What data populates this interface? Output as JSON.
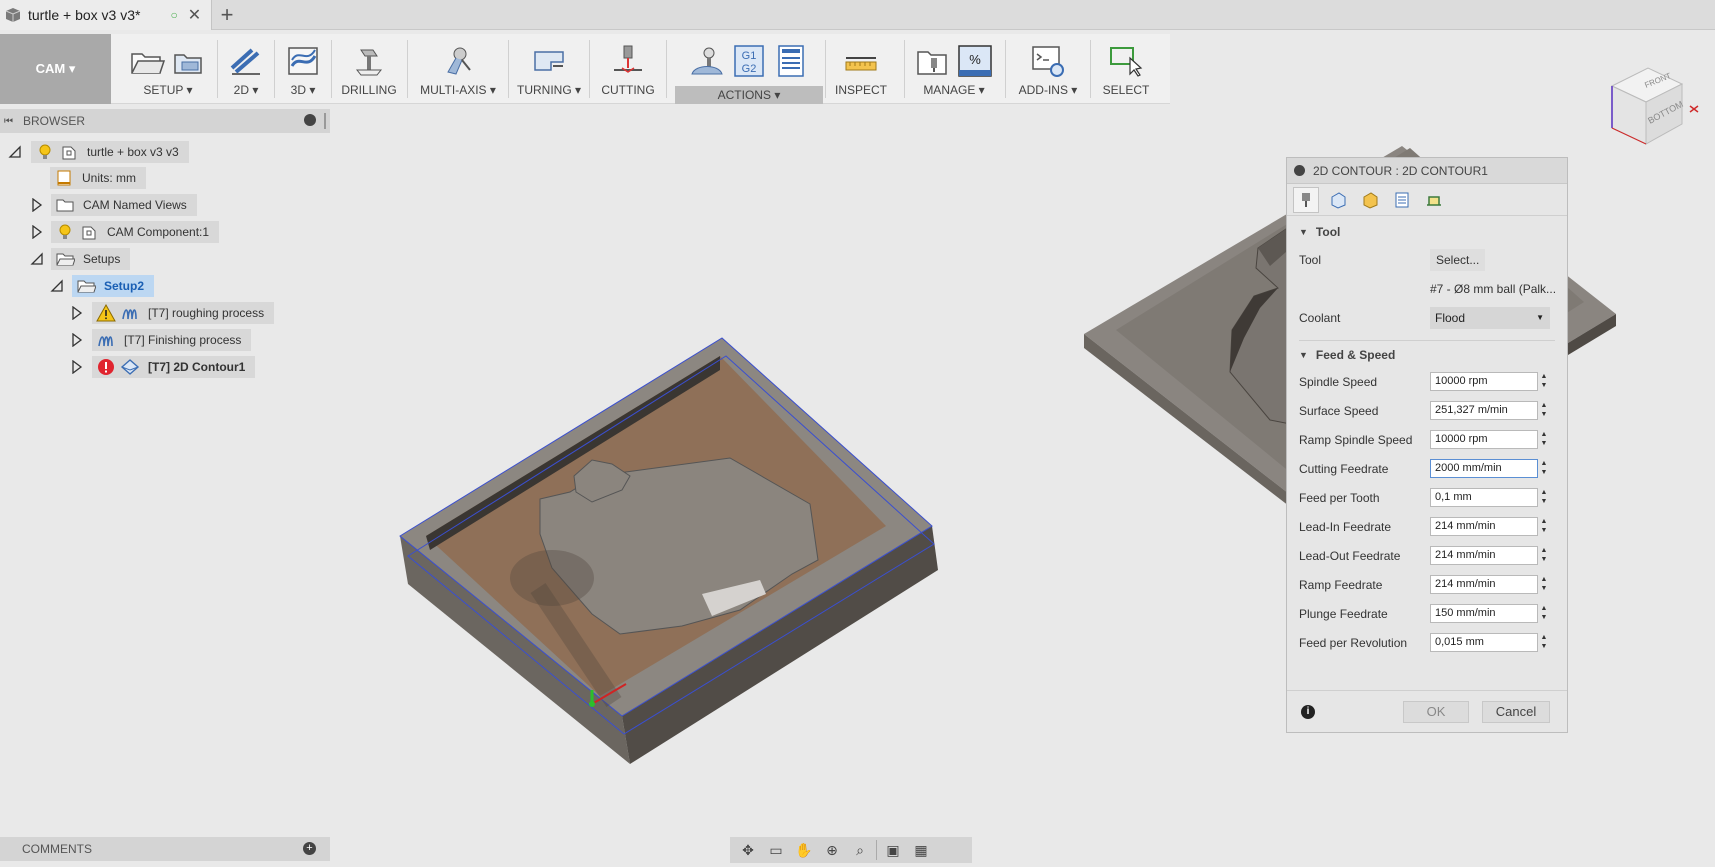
{
  "document": {
    "title": "turtle + box v3 v3*",
    "saved_indicator": "○",
    "close": "✕",
    "new_tab": "+"
  },
  "toolbar": {
    "workspace": "CAM ▾",
    "groups": [
      {
        "label": "SETUP ▾"
      },
      {
        "label": "2D ▾"
      },
      {
        "label": "3D ▾"
      },
      {
        "label": "DRILLING"
      },
      {
        "label": "MULTI-AXIS ▾"
      },
      {
        "label": "TURNING ▾"
      },
      {
        "label": "CUTTING"
      },
      {
        "label": "ACTIONS ▾"
      },
      {
        "label": "INSPECT"
      },
      {
        "label": "MANAGE ▾"
      },
      {
        "label": "ADD-INS ▾"
      },
      {
        "label": "SELECT"
      }
    ],
    "gcode_icon_text": [
      "G1",
      "G2"
    ],
    "manage_icon_text": "%"
  },
  "browser": {
    "title": "BROWSER",
    "items": [
      {
        "label": "turtle + box v3 v3"
      },
      {
        "label": "Units: mm"
      },
      {
        "label": "CAM Named Views"
      },
      {
        "label": "CAM Component:1"
      },
      {
        "label": "Setups"
      },
      {
        "label": "Setup2"
      },
      {
        "label": "[T7] roughing process"
      },
      {
        "label": "[T7] Finishing process"
      },
      {
        "label": "[T7] 2D Contour1"
      }
    ]
  },
  "comments": {
    "title": "COMMENTS",
    "add": "+"
  },
  "viewcube": {
    "top_face": "FRONT",
    "side_face": "BOTTOM"
  },
  "dialog": {
    "title": "2D CONTOUR : 2D CONTOUR1",
    "tool_section": "Tool",
    "tool_label": "Tool",
    "tool_button": "Select...",
    "tool_name": "#7 - Ø8 mm ball (Palk...",
    "coolant_label": "Coolant",
    "coolant_value": "Flood",
    "feed_section": "Feed & Speed",
    "fields": [
      {
        "label": "Spindle Speed",
        "value": "10000 rpm"
      },
      {
        "label": "Surface Speed",
        "value": "251,327 m/min"
      },
      {
        "label": "Ramp Spindle Speed",
        "value": "10000 rpm"
      },
      {
        "label": "Cutting Feedrate",
        "value": "2000 mm/min"
      },
      {
        "label": "Feed per Tooth",
        "value": "0,1 mm"
      },
      {
        "label": "Lead-In Feedrate",
        "value": "214 mm/min"
      },
      {
        "label": "Lead-Out Feedrate",
        "value": "214 mm/min"
      },
      {
        "label": "Ramp Feedrate",
        "value": "214 mm/min"
      },
      {
        "label": "Plunge Feedrate",
        "value": "150 mm/min"
      },
      {
        "label": "Feed per Revolution",
        "value": "0,015 mm"
      }
    ],
    "info": "i",
    "ok": "OK",
    "cancel": "Cancel"
  }
}
